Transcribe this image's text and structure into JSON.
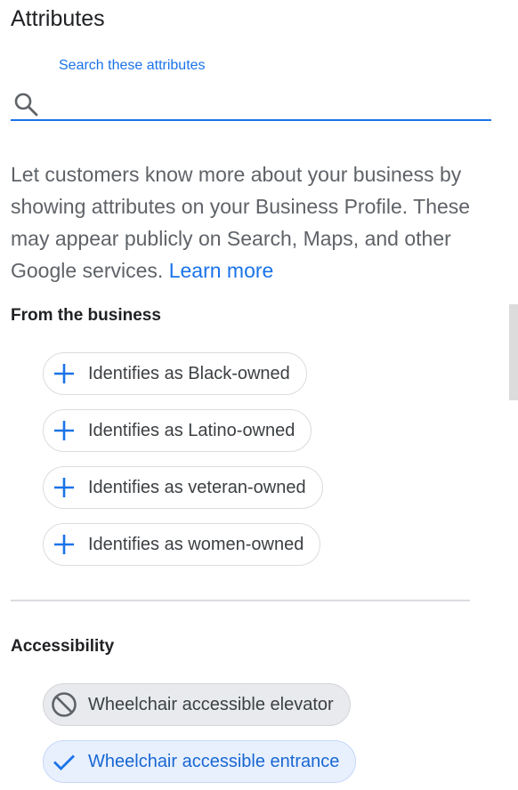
{
  "header": {
    "title": "Attributes"
  },
  "search": {
    "label": "Search these attributes",
    "value": "",
    "placeholder": ""
  },
  "description": {
    "text": "Let customers know more about your business by showing attributes on your Business Profile. These may appear publicly on Search, Maps, and other Google services.",
    "link": "Learn more"
  },
  "sections": {
    "business": {
      "title": "From the business",
      "items": [
        {
          "label": "Identifies as Black-owned",
          "icon": "plus-icon",
          "state": "unset"
        },
        {
          "label": "Identifies as Latino-owned",
          "icon": "plus-icon",
          "state": "unset"
        },
        {
          "label": "Identifies as veteran-owned",
          "icon": "plus-icon",
          "state": "unset"
        },
        {
          "label": "Identifies as women-owned",
          "icon": "plus-icon",
          "state": "unset"
        }
      ]
    },
    "accessibility": {
      "title": "Accessibility",
      "items": [
        {
          "label": "Wheelchair accessible elevator",
          "icon": "not-allowed-icon",
          "state": "no"
        },
        {
          "label": "Wheelchair accessible entrance",
          "icon": "check-icon",
          "state": "yes"
        }
      ]
    }
  },
  "colors": {
    "accent": "#1a73e8",
    "chip_border": "#dadce0",
    "chip_off_bg": "#e8eaed",
    "chip_on_bg": "#e8f0fe"
  }
}
